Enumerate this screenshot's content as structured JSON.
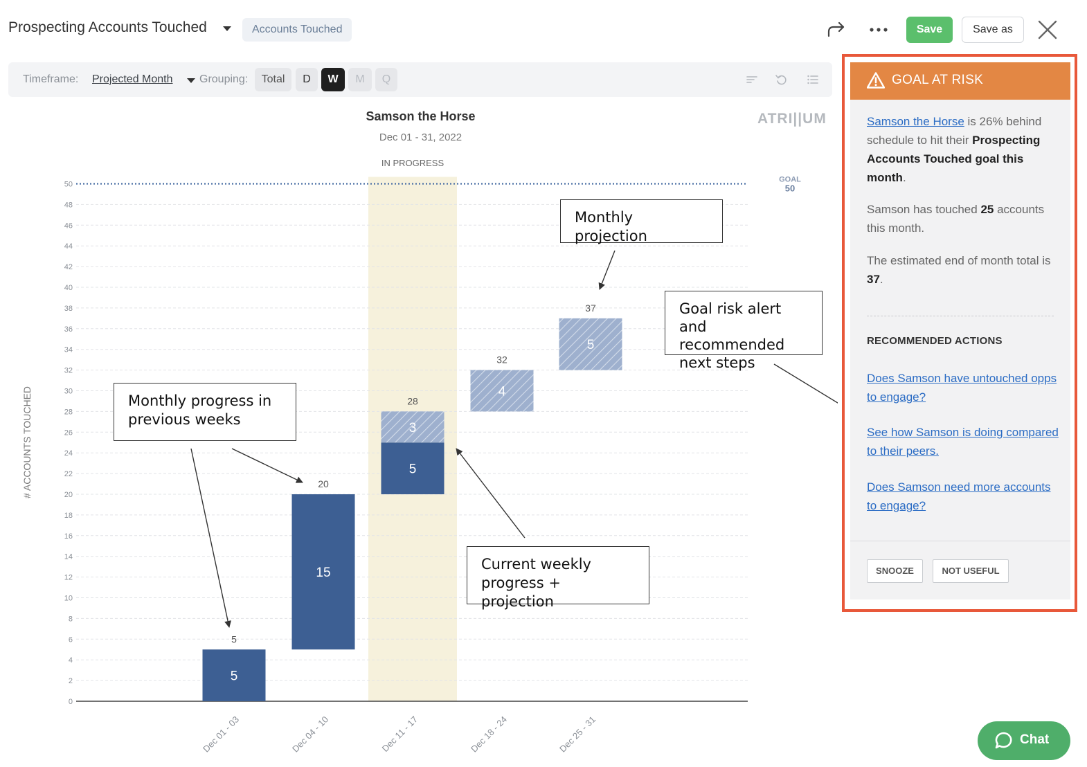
{
  "header": {
    "title": "Prospecting Accounts Touched",
    "tag": "Accounts Touched",
    "save_label": "Save",
    "save_as_label": "Save as"
  },
  "toolbar": {
    "timeframe_label": "Timeframe:",
    "timeframe_value": "Projected Month",
    "grouping_label": "Grouping:",
    "grouping_options": [
      "Total",
      "D",
      "W",
      "M",
      "Q"
    ],
    "grouping_selected": "W"
  },
  "chart_header": {
    "title": "Samson the Horse",
    "subtitle": "Dec 01 - 31, 2022",
    "logo": "ATRI||UM",
    "in_progress_label": "IN PROGRESS"
  },
  "chart_data": {
    "type": "bar",
    "chart_subtype": "waterfall",
    "title": "Samson the Horse",
    "subtitle": "Dec 01 - 31, 2022",
    "xlabel": "",
    "ylabel": "# ACCOUNTS TOUCHED",
    "ylim": [
      0,
      50
    ],
    "ytick_step": 2,
    "grid": true,
    "goal": {
      "label": "GOAL",
      "value": 50
    },
    "categories": [
      "Dec 01 - 03",
      "Dec 04 - 10",
      "Dec 11 - 17",
      "Dec 18 - 24",
      "Dec 25 - 31"
    ],
    "highlight_category_index": 2,
    "series": [
      {
        "kind": "actual",
        "values": [
          5,
          15,
          5,
          null,
          null
        ]
      },
      {
        "kind": "projected",
        "values": [
          null,
          null,
          3,
          4,
          5
        ]
      }
    ],
    "cumulative_totals": [
      5,
      20,
      28,
      32,
      37
    ],
    "colors": {
      "actual": "#3d5f93",
      "projected": "#9eb0ce",
      "highlight": "#f6f1dc",
      "goal_line": "#4a6fa5"
    }
  },
  "annotations": {
    "monthly_projection": "Monthly projection",
    "goal_risk": "Goal risk alert and recommended next steps",
    "monthly_progress": "Monthly progress in previous weeks",
    "current_weekly": "Current weekly progress + projection"
  },
  "goal_panel": {
    "title": "GOAL AT RISK",
    "name_link": "Samson the Horse",
    "msg_rest": " is 26% behind schedule to hit their ",
    "msg_bold": "Prospecting Accounts Touched goal this month",
    "msg_end": ".",
    "touched_pre": "Samson has touched ",
    "touched_value": "25",
    "touched_post": " accounts this month.",
    "estimate_pre": "The estimated end of month total is ",
    "estimate_value": "37",
    "estimate_post": ".",
    "recommended_title": "RECOMMENDED ACTIONS",
    "actions": [
      "Does Samson have untouched opps to engage?",
      "See how Samson is doing compared to their peers.",
      "Does Samson need more accounts to engage?"
    ],
    "snooze_label": "SNOOZE",
    "not_useful_label": "NOT USEFUL"
  },
  "chat": {
    "label": "Chat"
  }
}
